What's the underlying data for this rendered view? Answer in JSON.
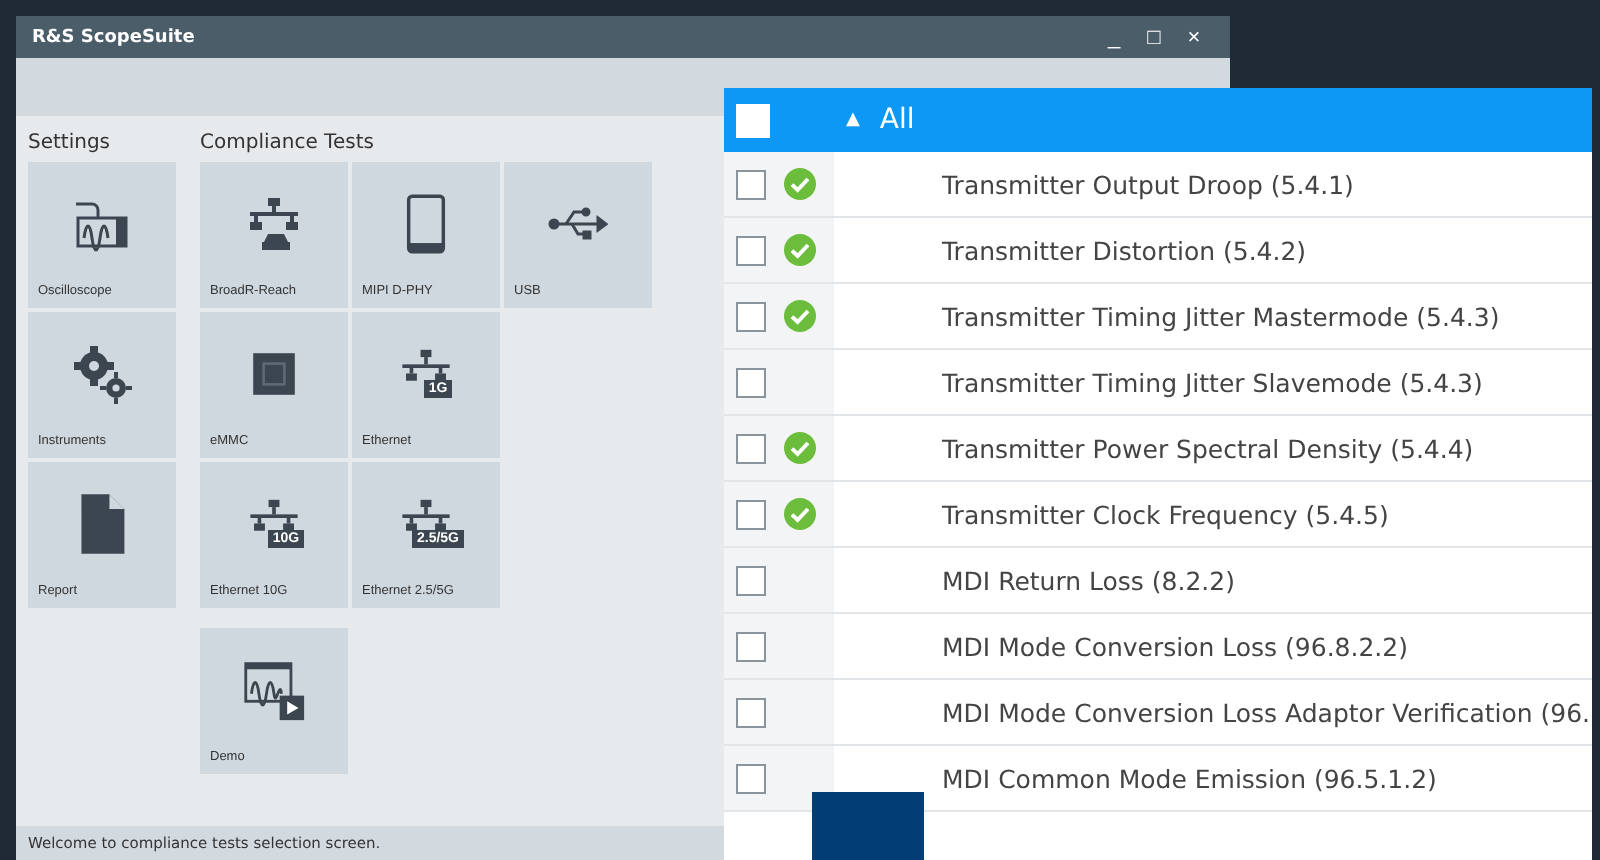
{
  "window": {
    "title": "R&S ScopeSuite",
    "controls": [
      "_",
      "□",
      "×"
    ]
  },
  "sections": [
    {
      "title": "Settings",
      "tile_rows": [
        [
          {
            "label": "Oscilloscope",
            "kind": "scope"
          }
        ],
        [
          {
            "label": "Instruments",
            "kind": "gears"
          }
        ],
        [
          {
            "label": "Report",
            "kind": "doc"
          }
        ]
      ]
    },
    {
      "title": "Compliance Tests",
      "tile_rows": [
        [
          {
            "label": "BroadR-Reach",
            "kind": "car"
          },
          {
            "label": "MIPI D-PHY",
            "kind": "tablet"
          },
          {
            "label": "USB",
            "kind": "usb"
          }
        ],
        [
          {
            "label": "eMMC",
            "kind": "chip"
          },
          {
            "label": "Ethernet",
            "kind": "net",
            "badge": "1G"
          }
        ],
        [
          {
            "label": "Ethernet 10G",
            "kind": "net",
            "badge": "10G"
          },
          {
            "label": "Ethernet 2.5/5G",
            "kind": "net",
            "badge": "2.5/5G"
          }
        ],
        [
          {
            "label": "Demo",
            "kind": "demo"
          }
        ]
      ]
    }
  ],
  "status_bar": "Welcome to compliance tests selection screen.",
  "test_list": {
    "header": {
      "label": "All",
      "caret": "▲",
      "checked": false
    },
    "rows": [
      {
        "name": "Transmitter Output Droop (5.4.1)",
        "checked": false,
        "passed": true
      },
      {
        "name": "Transmitter Distortion (5.4.2)",
        "checked": false,
        "passed": true
      },
      {
        "name": "Transmitter Timing Jitter Mastermode (5.4.3)",
        "checked": false,
        "passed": true
      },
      {
        "name": "Transmitter Timing Jitter Slavemode (5.4.3)",
        "checked": false,
        "passed": false
      },
      {
        "name": "Transmitter Power Spectral Density (5.4.4)",
        "checked": false,
        "passed": true
      },
      {
        "name": "Transmitter Clock Frequency (5.4.5)",
        "checked": false,
        "passed": true
      },
      {
        "name": "MDI Return Loss (8.2.2)",
        "checked": false,
        "passed": false
      },
      {
        "name": "MDI Mode Conversion Loss (96.8.2.2)",
        "checked": false,
        "passed": false
      },
      {
        "name": "MDI Mode Conversion Loss Adaptor Verification (96.",
        "checked": false,
        "passed": false
      },
      {
        "name": "MDI Common Mode Emission (96.5.1.2)",
        "checked": false,
        "passed": false
      }
    ]
  }
}
